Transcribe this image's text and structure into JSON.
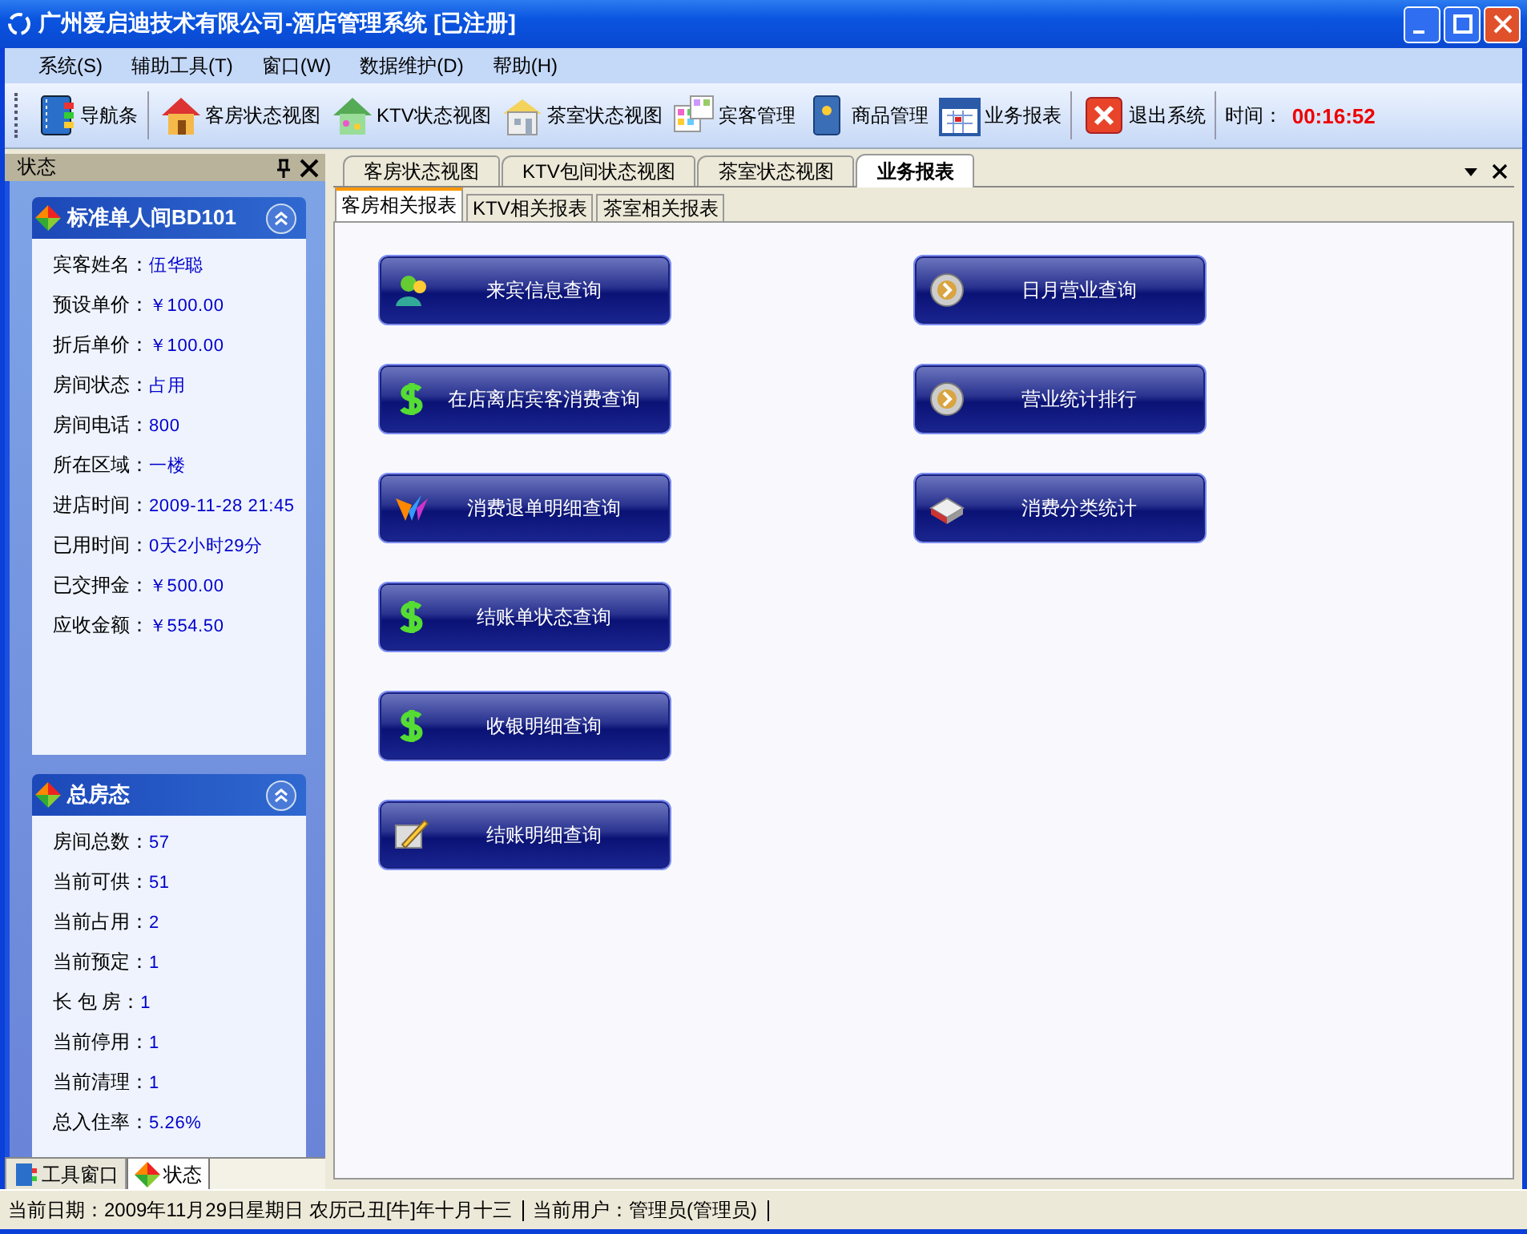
{
  "window": {
    "title": "广州爱启迪技术有限公司-酒店管理系统 [已注册]"
  },
  "menu": [
    {
      "label": "系统(S)"
    },
    {
      "label": "辅助工具(T)"
    },
    {
      "label": "窗口(W)"
    },
    {
      "label": "数据维护(D)"
    },
    {
      "label": "帮助(H)"
    }
  ],
  "toolbar": [
    {
      "label": "导航条"
    },
    {
      "label": "客房状态视图"
    },
    {
      "label": "KTV状态视图"
    },
    {
      "label": "茶室状态视图"
    },
    {
      "label": "宾客管理"
    },
    {
      "label": "商品管理"
    },
    {
      "label": "业务报表"
    },
    {
      "label": "退出系统"
    }
  ],
  "clock": {
    "label": "时间：",
    "value": "00:16:52"
  },
  "left_panel": {
    "title": "状态",
    "cards": [
      {
        "title": "标准单人间BD101",
        "fields": [
          {
            "label": "宾客姓名：",
            "value": "伍华聪"
          },
          {
            "label": "预设单价：",
            "value": "￥100.00"
          },
          {
            "label": "折后单价：",
            "value": "￥100.00"
          },
          {
            "label": "房间状态：",
            "value": "占用"
          },
          {
            "label": "房间电话：",
            "value": "800"
          },
          {
            "label": "所在区域：",
            "value": "一楼"
          },
          {
            "label": "进店时间：",
            "value": "2009-11-28 21:45"
          },
          {
            "label": "已用时间：",
            "value": "0天2小时29分"
          },
          {
            "label": "已交押金：",
            "value": "￥500.00"
          },
          {
            "label": "应收金额：",
            "value": "￥554.50"
          }
        ]
      },
      {
        "title": "总房态",
        "fields": [
          {
            "label": "房间总数：",
            "value": "57"
          },
          {
            "label": "当前可供：",
            "value": "51"
          },
          {
            "label": "当前占用：",
            "value": "2"
          },
          {
            "label": "当前预定：",
            "value": "1"
          },
          {
            "label": "长 包 房：",
            "value": "1"
          },
          {
            "label": "当前停用：",
            "value": "1"
          },
          {
            "label": "当前清理：",
            "value": "1"
          },
          {
            "label": "总入住率：",
            "value": "5.26%"
          }
        ]
      }
    ],
    "bottom_tabs": [
      {
        "label": "工具窗口",
        "selected": false
      },
      {
        "label": "状态",
        "selected": true
      }
    ]
  },
  "tabs": [
    {
      "label": "客房状态视图",
      "selected": false
    },
    {
      "label": "KTV包间状态视图",
      "selected": false
    },
    {
      "label": "茶室状态视图",
      "selected": false
    },
    {
      "label": "业务报表",
      "selected": true
    }
  ],
  "subtabs": [
    {
      "label": "客房相关报表",
      "selected": true
    },
    {
      "label": "KTV相关报表",
      "selected": false
    },
    {
      "label": "茶室相关报表",
      "selected": false
    }
  ],
  "report_buttons": {
    "left": [
      {
        "label": "来宾信息查询"
      },
      {
        "label": "在店离店宾客消费查询"
      },
      {
        "label": "消费退单明细查询"
      },
      {
        "label": "结账单状态查询"
      },
      {
        "label": "收银明细查询"
      },
      {
        "label": "结账明细查询"
      }
    ],
    "right": [
      {
        "label": "日月营业查询"
      },
      {
        "label": "营业统计排行"
      },
      {
        "label": "消费分类统计"
      }
    ]
  },
  "status_bar": [
    {
      "text": "当前日期：2009年11月29日星期日 农历己丑[牛]年十月十三"
    },
    {
      "text": "当前用户：管理员(管理员)"
    }
  ]
}
